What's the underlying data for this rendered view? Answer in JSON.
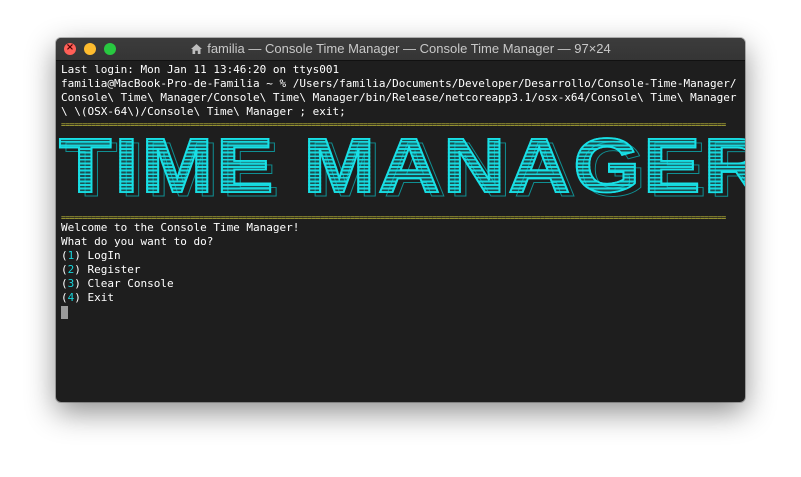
{
  "window": {
    "title": "familia — Console Time Manager — Console Time Manager — 97×24"
  },
  "terminal": {
    "last_login": "Last login: Mon Jan 11 13:46:20 on ttys001",
    "command": "familia@MacBook-Pro-de-Familia ~ % /Users/familia/Documents/Developer/Desarrollo/Console-Time-Manager/Console\\ Time\\ Manager/Console\\ Time\\ Manager/bin/Release/netcoreapp3.1/osx-x64/Console\\ Time\\ Manager\\ \\(OSX-64\\)/Console\\ Time\\ Manager ; exit;",
    "separator": "==========================================================================================================================================================",
    "banner": "TIME MANAGER",
    "welcome": "Welcome to the Console Time Manager!",
    "prompt": "What do you want to do?",
    "menu": [
      {
        "num": "1",
        "label": "LogIn"
      },
      {
        "num": "2",
        "label": "Register"
      },
      {
        "num": "3",
        "label": "Clear Console"
      },
      {
        "num": "4",
        "label": "Exit"
      }
    ]
  },
  "colors": {
    "banner": "#18e0e6",
    "separator": "#d4cf3b",
    "menu_number": "#19d6dc",
    "background": "#1e1e1e"
  }
}
